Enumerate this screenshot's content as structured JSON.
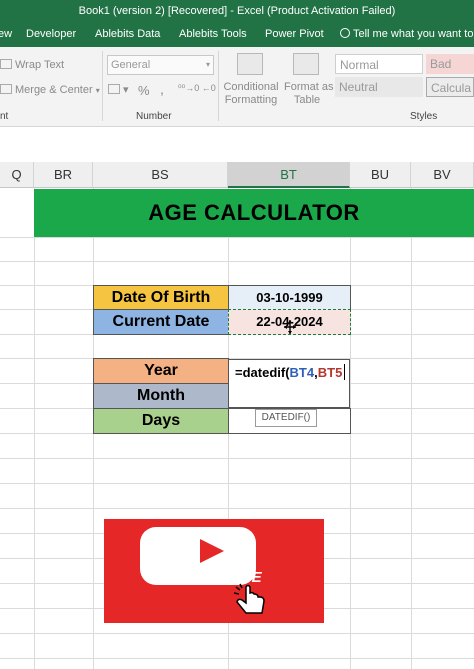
{
  "window": {
    "title": "Book1 (version 2) [Recovered] - Excel (Product Activation Failed)"
  },
  "menu": {
    "tabs": [
      "ew",
      "Developer",
      "Ablebits Data",
      "Ablebits Tools",
      "Power Pivot"
    ],
    "tellme": "Tell me what you want to"
  },
  "ribbon": {
    "wrap_text": "Wrap Text",
    "merge_center": "Merge & Center",
    "number_format": "General",
    "percent": "%",
    "comma": ",",
    "conditional_formatting": [
      "Conditional",
      "Formatting"
    ],
    "format_as_table": [
      "Format as",
      "Table"
    ],
    "styles": {
      "normal": "Normal",
      "bad": "Bad",
      "neutral": "Neutral",
      "calculation": "Calcula"
    },
    "group_alignment_tail": "nt",
    "group_number": "Number",
    "group_styles": "Styles"
  },
  "columns": [
    "Q",
    "BR",
    "BS",
    "BT",
    "BU",
    "BV"
  ],
  "sheet": {
    "banner": "AGE CALCULATOR",
    "labels": {
      "dob": "Date Of Birth",
      "current": "Current Date",
      "year": "Year",
      "month": "Month",
      "days": "Days"
    },
    "values": {
      "dob": "03-10-1999",
      "current": "22-04-2024"
    },
    "formula": {
      "prefix": "=datedif(",
      "ref1": "BT4",
      "comma": ",",
      "ref2": "BT5"
    },
    "tooltip": "DATEDIF()"
  },
  "subscribe": {
    "label": "SUBSCRIBE"
  },
  "colors": {
    "excel_green": "#217346",
    "banner": "#1aa84a",
    "dob_fill": "#f5c542",
    "current_fill": "#8eb4e3",
    "year_fill": "#f4b183",
    "month_fill": "#adb9ca",
    "days_fill": "#a9d18e",
    "subscribe_red": "#e52727"
  }
}
